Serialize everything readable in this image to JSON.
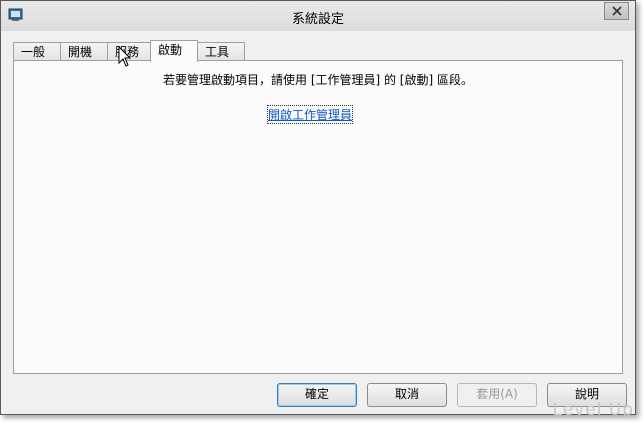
{
  "window": {
    "title": "系統設定",
    "close_icon": "close-icon"
  },
  "tabs": [
    {
      "label": "一般",
      "active": false
    },
    {
      "label": "開機",
      "active": false
    },
    {
      "label": "服務",
      "active": false
    },
    {
      "label": "啟動",
      "active": true
    },
    {
      "label": "工具",
      "active": false
    }
  ],
  "startup_panel": {
    "message": "若要管理啟動項目，請使用 [工作管理員] 的 [啟動] 區段。",
    "link": "開啟工作管理員"
  },
  "buttons": {
    "ok": "確定",
    "cancel": "取消",
    "apply": "套用(A)",
    "help": "說明"
  },
  "watermark": "Level Up"
}
